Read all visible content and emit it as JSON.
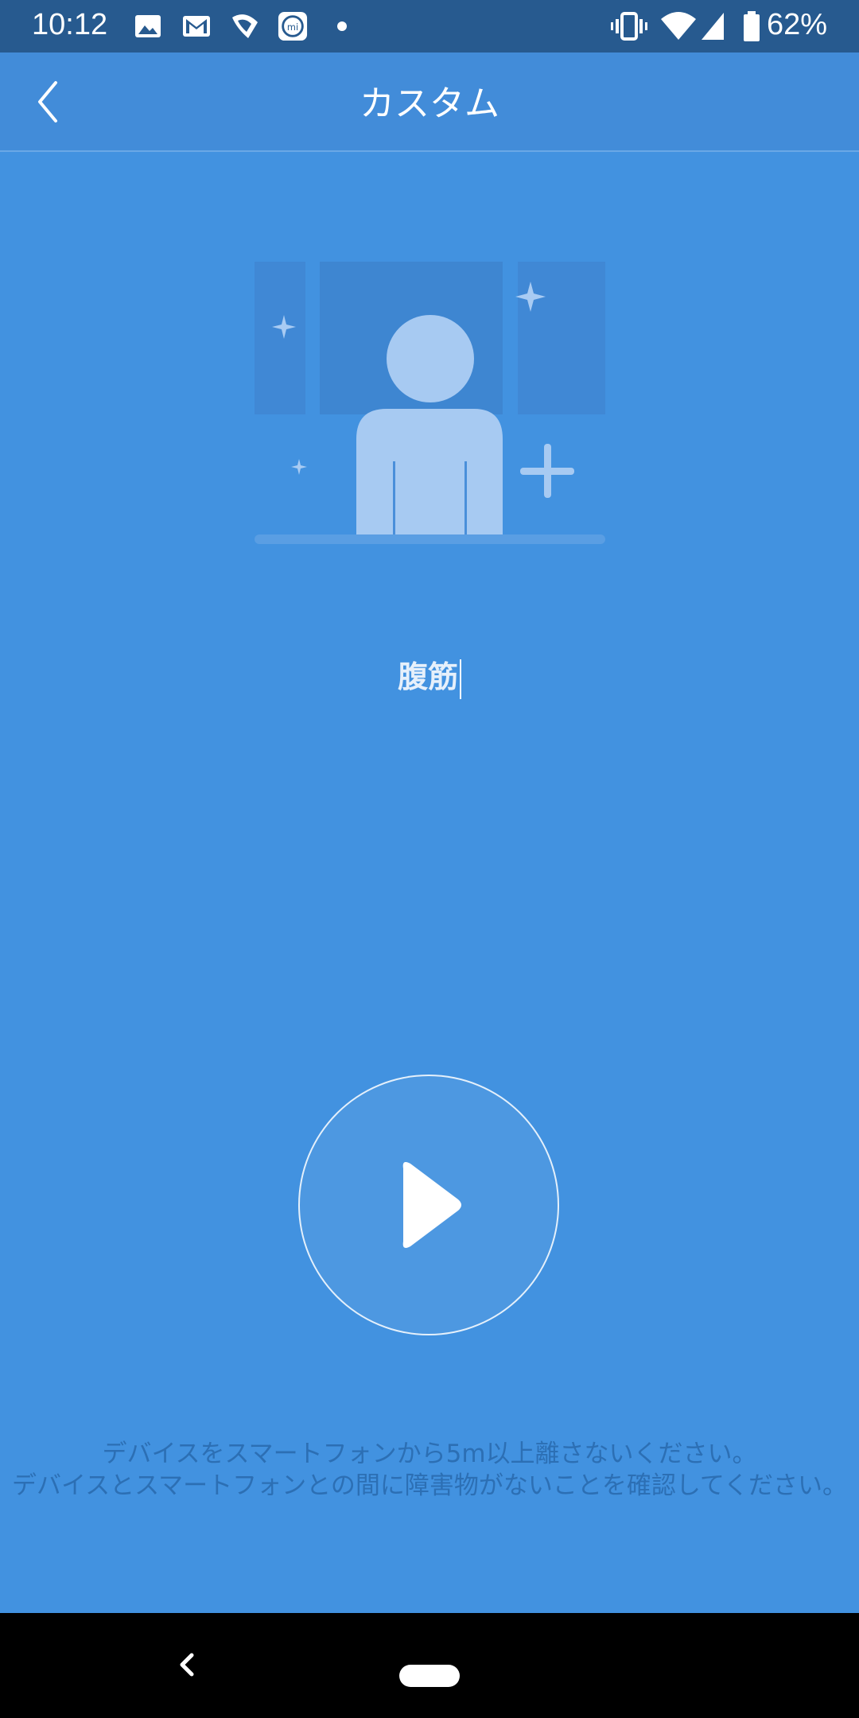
{
  "status_bar": {
    "time": "10:12",
    "battery": "62%",
    "icons": [
      "image-icon",
      "gmail-icon",
      "notification-icon",
      "mi-fit-icon",
      "dot-icon",
      "vibrate-icon",
      "wifi-icon",
      "signal-icon",
      "battery-icon"
    ]
  },
  "header": {
    "title": "カスタム",
    "back_icon": "chevron-left-icon"
  },
  "illustration": {
    "icon": "add-person-icon"
  },
  "name_field": {
    "value": "腹筋"
  },
  "play_button": {
    "icon": "play-icon"
  },
  "notice": {
    "line1": "デバイスをスマートフォンから5m以上離さないください。",
    "line2": "デバイスとスマートフォンとの間に障害物がないことを確認してください。"
  },
  "nav_bar": {
    "back_icon": "nav-back-icon",
    "home_icon": "nav-home-pill"
  },
  "colors": {
    "background": "#4292e0",
    "status_bar": "#275a8f",
    "header": "#428cd9",
    "notice_text": "#2c6fb4"
  }
}
